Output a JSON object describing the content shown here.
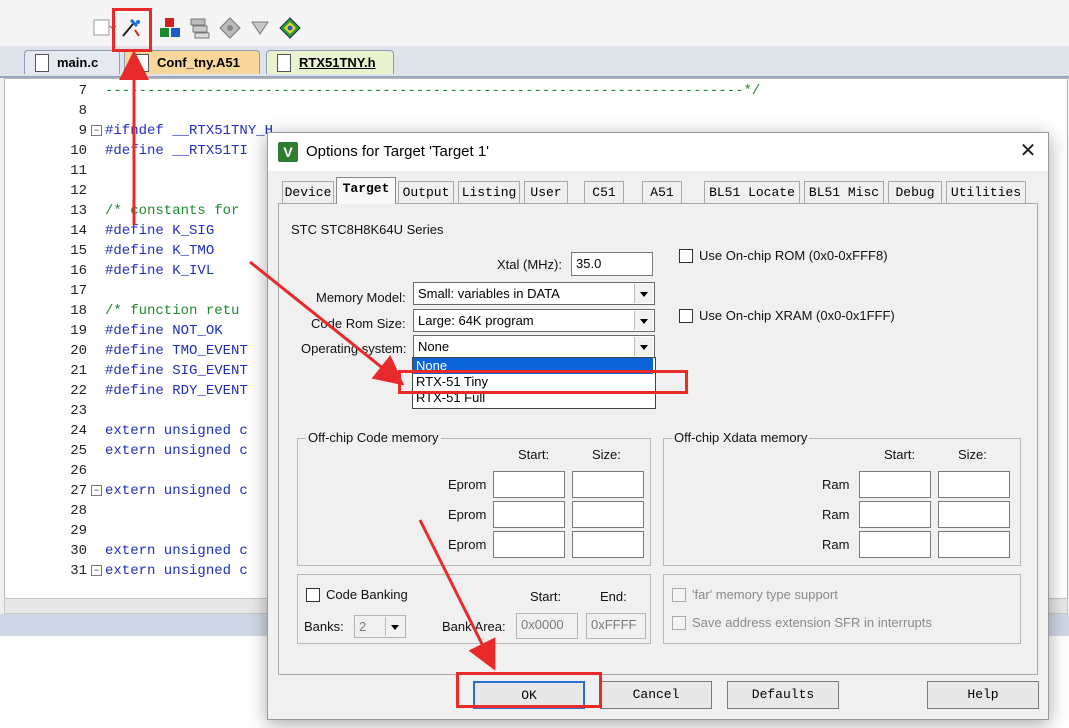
{
  "editor": {
    "tabs": [
      {
        "label": "main.c"
      },
      {
        "label": "Conf_tny.A51"
      },
      {
        "label": "RTX51TNY.h"
      }
    ],
    "lines": [
      {
        "num": "7",
        "text": "----------------------------------------------------------------------------*/",
        "kind": "cmt"
      },
      {
        "num": "8",
        "text": "",
        "kind": "code"
      },
      {
        "num": "9",
        "text": "#ifndef __RTX51TNY_H",
        "kind": "code"
      },
      {
        "num": "10",
        "text": "#define __RTX51TI",
        "kind": "code"
      },
      {
        "num": "11",
        "text": "",
        "kind": "code"
      },
      {
        "num": "12",
        "text": "",
        "kind": "code"
      },
      {
        "num": "13",
        "text": "/* constants for",
        "kind": "cmt"
      },
      {
        "num": "14",
        "text": "#define K_SIG",
        "kind": "code"
      },
      {
        "num": "15",
        "text": "#define K_TMO",
        "kind": "code"
      },
      {
        "num": "16",
        "text": "#define K_IVL",
        "kind": "code"
      },
      {
        "num": "17",
        "text": "",
        "kind": "code"
      },
      {
        "num": "18",
        "text": "/* function retu",
        "kind": "cmt"
      },
      {
        "num": "19",
        "text": "#define NOT_OK",
        "kind": "code"
      },
      {
        "num": "20",
        "text": "#define TMO_EVENT",
        "kind": "code"
      },
      {
        "num": "21",
        "text": "#define SIG_EVENT",
        "kind": "code"
      },
      {
        "num": "22",
        "text": "#define RDY_EVENT",
        "kind": "code"
      },
      {
        "num": "23",
        "text": "",
        "kind": "code"
      },
      {
        "num": "24",
        "text": "extern unsigned c",
        "kind": "code"
      },
      {
        "num": "25",
        "text": "extern unsigned c",
        "kind": "code"
      },
      {
        "num": "26",
        "text": "",
        "kind": "code"
      },
      {
        "num": "27",
        "text": "extern unsigned c",
        "kind": "code"
      },
      {
        "num": "28",
        "text": "",
        "kind": "code"
      },
      {
        "num": "29",
        "text": "",
        "kind": "code"
      },
      {
        "num": "30",
        "text": "extern unsigned c",
        "kind": "code"
      },
      {
        "num": "31",
        "text": "extern unsigned c",
        "kind": "code"
      }
    ]
  },
  "dialog": {
    "title": "Options for Target 'Target 1'",
    "close_glyph": "✕",
    "app_icon_glyph": "V",
    "tabs": [
      "Device",
      "Target",
      "Output",
      "Listing",
      "User",
      "C51",
      "A51",
      "BL51 Locate",
      "BL51 Misc",
      "Debug",
      "Utilities"
    ],
    "active_tab": "Target",
    "device_series": "STC STC8H8K64U Series",
    "xtal_label": "Xtal (MHz):",
    "xtal_value": "35.0",
    "use_onchip_rom": "Use On-chip ROM (0x0-0xFFF8)",
    "use_onchip_xram": "Use On-chip XRAM (0x0-0x1FFF)",
    "memory_model_label": "Memory Model:",
    "memory_model_value": "Small: variables in DATA",
    "code_rom_size_label": "Code Rom Size:",
    "code_rom_size_value": "Large: 64K program",
    "operating_system_label": "Operating system:",
    "operating_system_value": "None",
    "operating_system_options": [
      "None",
      "RTX-51 Tiny",
      "RTX-51 Full"
    ],
    "offchip_code": {
      "title": "Off-chip Code memory",
      "start_label": "Start:",
      "size_label": "Size:",
      "rows": [
        "Eprom",
        "Eprom",
        "Eprom"
      ]
    },
    "offchip_xdata": {
      "title": "Off-chip Xdata memory",
      "start_label": "Start:",
      "size_label": "Size:",
      "rows": [
        "Ram",
        "Ram",
        "Ram"
      ]
    },
    "code_banking": {
      "label": "Code Banking",
      "start_label": "Start:",
      "end_label": "End:",
      "banks_label": "Banks:",
      "banks_value": "2",
      "bank_area_label": "Bank Area:",
      "bank_area_start": "0x0000",
      "bank_area_end": "0xFFFF"
    },
    "far_memory": "'far' memory type support",
    "save_address_ext": "Save address extension SFR in interrupts",
    "buttons": {
      "ok": "OK",
      "cancel": "Cancel",
      "defaults": "Defaults",
      "help": "Help"
    }
  },
  "colors": {
    "annotation_red": "#e82a2a",
    "selection_blue": "#0a64d8",
    "code_blue": "#1f2fbf",
    "comment_green": "#1e8a2e"
  }
}
